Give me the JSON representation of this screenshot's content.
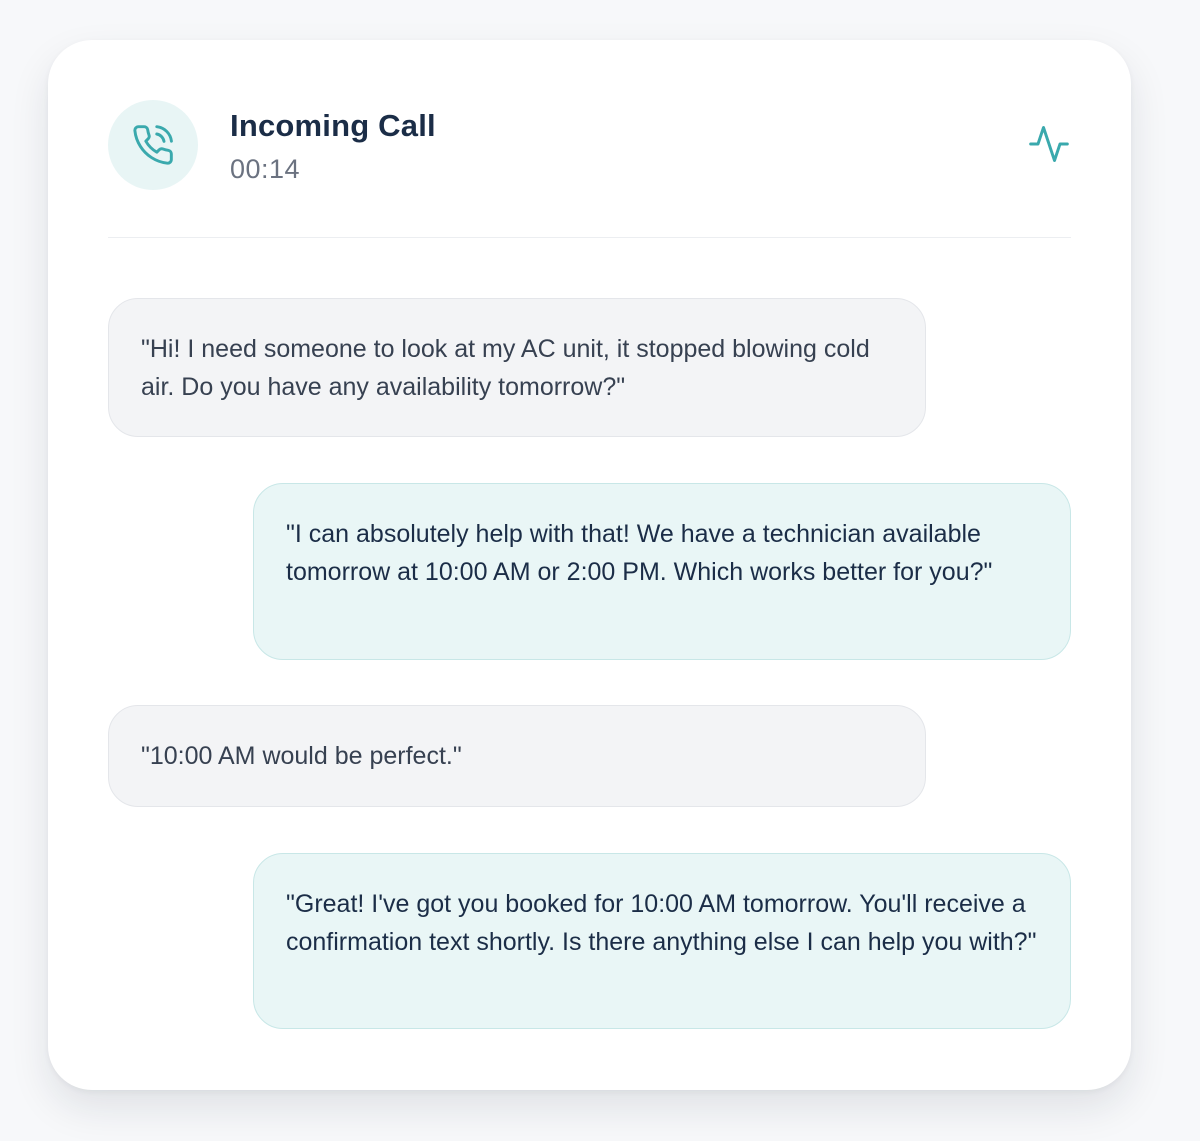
{
  "call": {
    "title": "Incoming Call",
    "timer": "00:14"
  },
  "icons": {
    "avatar": "phone-call-icon",
    "status": "activity-pulse-icon"
  },
  "colors": {
    "accent": "#3aa9ad",
    "avatar_bg": "#e8f5f5",
    "caller_bubble": "#f3f4f6",
    "agent_bubble": "#e9f6f6",
    "title": "#1b2d47"
  },
  "messages": [
    {
      "speaker": "caller",
      "text": "\"Hi! I need someone to look at my AC unit, it stopped blowing cold air. Do you have any availability tomorrow?\""
    },
    {
      "speaker": "agent",
      "text": "\"I can absolutely help with that! We have a technician available tomorrow at 10:00 AM or 2:00 PM. Which works better for you?\""
    },
    {
      "speaker": "caller",
      "text": "\"10:00 AM would be perfect.\""
    },
    {
      "speaker": "agent",
      "text": "\"Great! I've got you booked for 10:00 AM tomorrow. You'll receive a confirmation text shortly. Is there anything else I can help you with?\""
    }
  ]
}
